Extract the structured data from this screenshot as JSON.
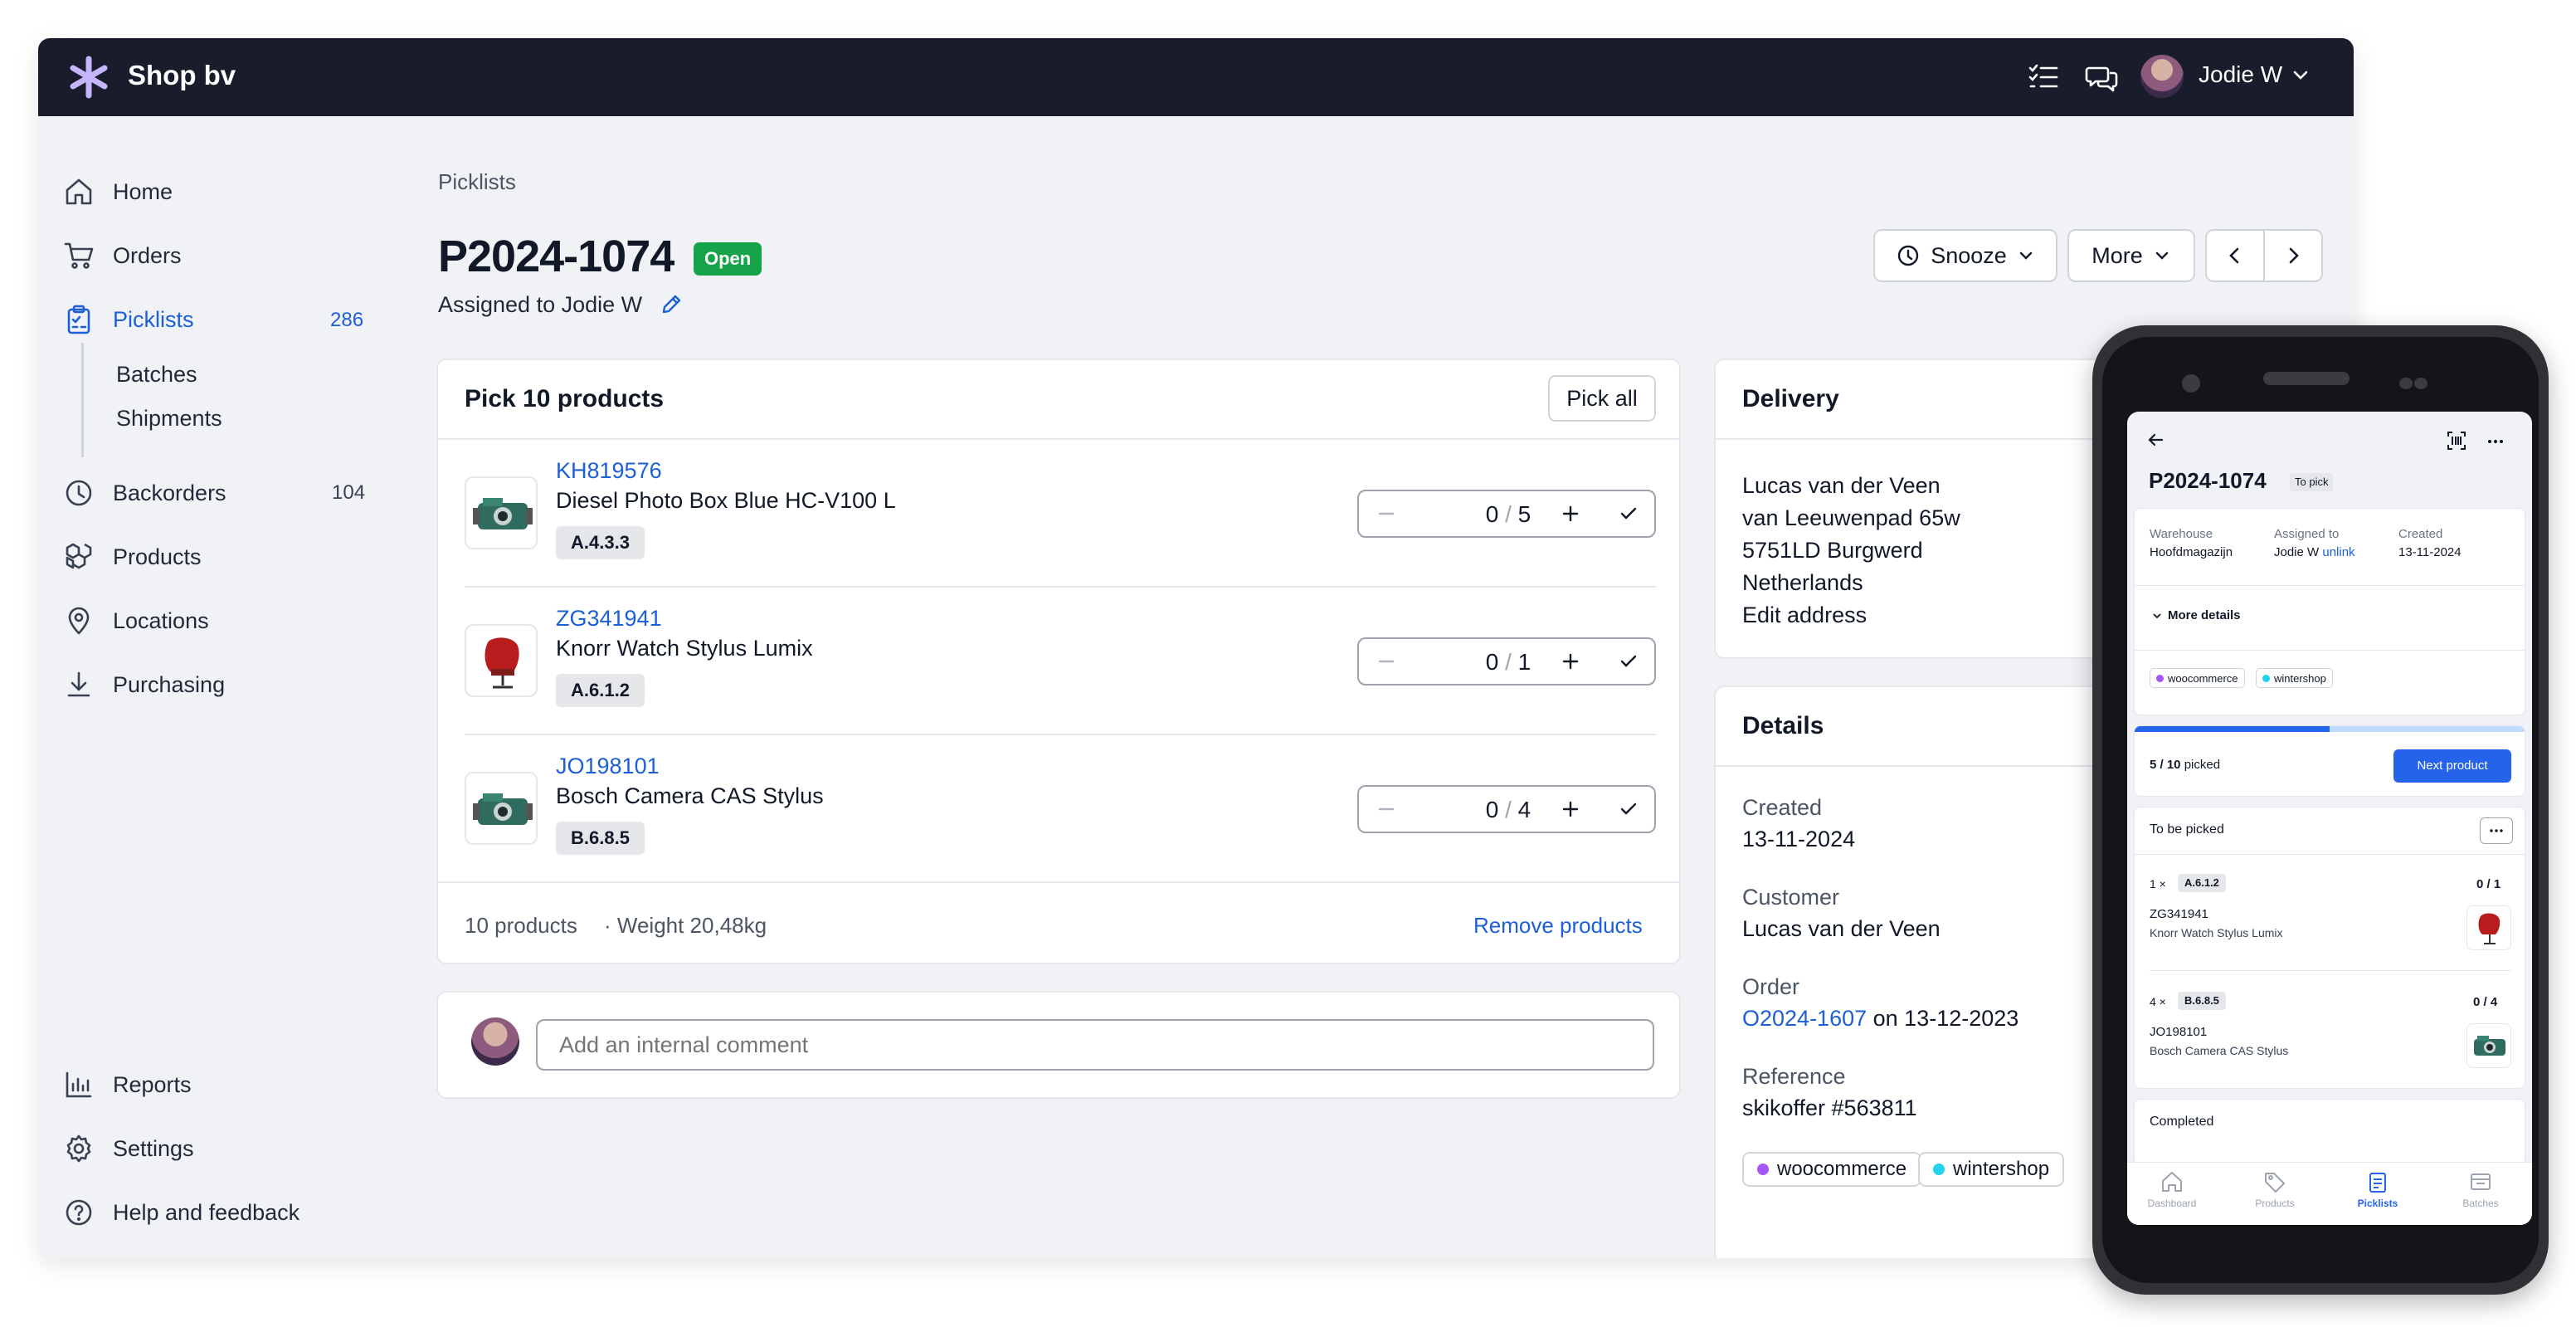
{
  "app": {
    "name": "Shop bv",
    "user": "Jodie W"
  },
  "sidebar": {
    "items": [
      {
        "label": "Home",
        "icon": "home-icon"
      },
      {
        "label": "Orders",
        "icon": "cart-icon"
      },
      {
        "label": "Picklists",
        "icon": "clipboard-icon",
        "count": "286",
        "active": true
      },
      {
        "label": "Backorders",
        "icon": "clock-icon",
        "count": "104"
      },
      {
        "label": "Products",
        "icon": "boxes-icon"
      },
      {
        "label": "Locations",
        "icon": "pin-icon"
      },
      {
        "label": "Purchasing",
        "icon": "download-icon"
      }
    ],
    "sub": [
      "Batches",
      "Shipments"
    ],
    "bottom": [
      {
        "label": "Reports",
        "icon": "chart-icon"
      },
      {
        "label": "Settings",
        "icon": "gear-icon"
      },
      {
        "label": "Help and feedback",
        "icon": "help-icon"
      }
    ]
  },
  "page": {
    "breadcrumb": "Picklists",
    "title": "P2024-1074",
    "status": "Open",
    "assigned": "Assigned to Jodie W",
    "actions": {
      "snooze": "Snooze",
      "more": "More"
    }
  },
  "pick": {
    "title": "Pick 10 products",
    "pick_all": "Pick all",
    "products": [
      {
        "sku": "KH819576",
        "name": "Diesel Photo Box Blue HC-V100 L",
        "location": "A.4.3.3",
        "picked": "0",
        "total": "5"
      },
      {
        "sku": "ZG341941",
        "name": "Knorr Watch Stylus Lumix",
        "location": "A.6.1.2",
        "picked": "0",
        "total": "1"
      },
      {
        "sku": "JO198101",
        "name": "Bosch Camera CAS Stylus",
        "location": "B.6.8.5",
        "picked": "0",
        "total": "4"
      }
    ],
    "footer_count": "10 products",
    "footer_weight": "· Weight 20,48kg",
    "remove": "Remove products"
  },
  "comment": {
    "placeholder": "Add an internal comment"
  },
  "delivery": {
    "title": "Delivery",
    "name": "Lucas van der Veen",
    "street": "van Leeuwenpad 65w",
    "city": "5751LD Burgwerd",
    "country": "Netherlands",
    "edit": "Edit address"
  },
  "details": {
    "title": "Details",
    "created_label": "Created",
    "created": "13-11-2024",
    "customer_label": "Customer",
    "customer": "Lucas van der Veen",
    "order_label": "Order",
    "order": "O2024-1607",
    "order_date": "on 13-12-2023",
    "reference_label": "Reference",
    "reference": "skikoffer #563811",
    "tags": [
      {
        "label": "woocommerce",
        "color": "#a855f7"
      },
      {
        "label": "wintershop",
        "color": "#22d3ee"
      }
    ]
  },
  "mobile": {
    "title": "P2024-1074",
    "status": "To pick",
    "warehouse_label": "Warehouse",
    "warehouse": "Hoofdmagazijn",
    "assigned_label": "Assigned to",
    "assigned": "Jodie W",
    "unlink": "unlink",
    "created_label": "Created",
    "created": "13-11-2024",
    "more_details": "More details",
    "tags": [
      "woocommerce",
      "wintershop"
    ],
    "progress": {
      "picked": "5 / 10",
      "label": "picked",
      "fraction": 0.5
    },
    "next": "Next product",
    "to_be_picked": "To be picked",
    "items": [
      {
        "qty": "1",
        "location": "A.6.1.2",
        "picked": "0 / 1",
        "sku": "ZG341941",
        "name": "Knorr Watch Stylus Lumix"
      },
      {
        "qty": "4",
        "location": "B.6.8.5",
        "picked": "0 / 4",
        "sku": "JO198101",
        "name": "Bosch Camera CAS Stylus"
      }
    ],
    "completed": "Completed",
    "tabs": [
      "Dashboard",
      "Products",
      "Picklists",
      "Batches"
    ]
  }
}
